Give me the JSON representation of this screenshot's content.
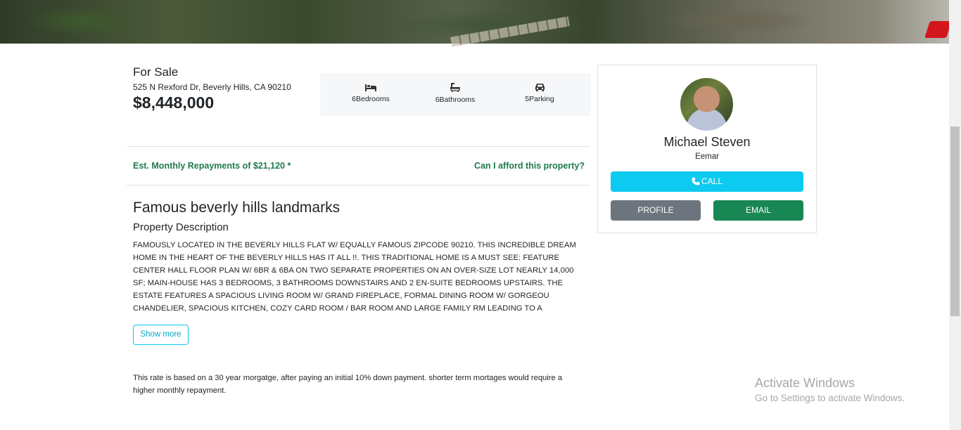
{
  "listing": {
    "status": "For Sale",
    "address": "525 N Rexford Dr, Beverly Hills, CA 90210",
    "price": "$8,448,000"
  },
  "features": [
    {
      "icon": "bed-icon",
      "label": "6Bedrooms"
    },
    {
      "icon": "bath-icon",
      "label": "6Bathrooms"
    },
    {
      "icon": "car-icon",
      "label": "5Parking"
    }
  ],
  "repayments": {
    "estimate": "Est. Monthly Repayments of $21,120 *",
    "afford_link": "Can I afford this property?"
  },
  "property": {
    "title": "Famous beverly hills landmarks",
    "description_heading": "Property Description",
    "description": "FAMOUSLY LOCATED IN THE BEVERLY HILLS FLAT W/ EQUALLY FAMOUS ZIPCODE 90210. THIS INCREDIBLE DREAM HOME IN THE HEART OF THE BEVERLY HILLS HAS IT ALL !!. THIS TRADITIONAL HOME IS A MUST SEE: FEATURE CENTER HALL FLOOR PLAN W/ 6BR & 6BA ON TWO SEPARATE PROPERTIES ON AN OVER-SIZE LOT NEARLY 14,000 SF; MAIN-HOUSE HAS 3 BEDROOMS, 3 BATHROOMS DOWNSTAIRS AND 2 EN-SUITE BEDROOMS UPSTAIRS. THE ESTATE FEATURES A SPACIOUS LIVING ROOM W/ GRAND FIREPLACE, FORMAL DINING ROOM W/ GORGEOU CHANDELIER, SPACIOUS KITCHEN, COZY CARD ROOM / BAR ROOM AND LARGE FAMILY RM LEADING TO A BEAUTIFULLY & PRIVATE",
    "show_more_label": "Show more",
    "rate_note": "This rate is based on a 30 year morgatge, after paying an initial 10% down payment. shorter term mortages would require a higher monthly repayment."
  },
  "agent": {
    "name": "Michael Steven",
    "company": "Eemar",
    "call_label": "CALL",
    "profile_label": "PROFILE",
    "email_label": "EMAIL"
  },
  "watermark": {
    "title": "Activate Windows",
    "subtitle": "Go to Settings to activate Windows."
  },
  "colors": {
    "accent_green": "#1f7a4d",
    "call_button": "#0dcaf0",
    "profile_button": "#6c757d",
    "email_button": "#198754"
  }
}
